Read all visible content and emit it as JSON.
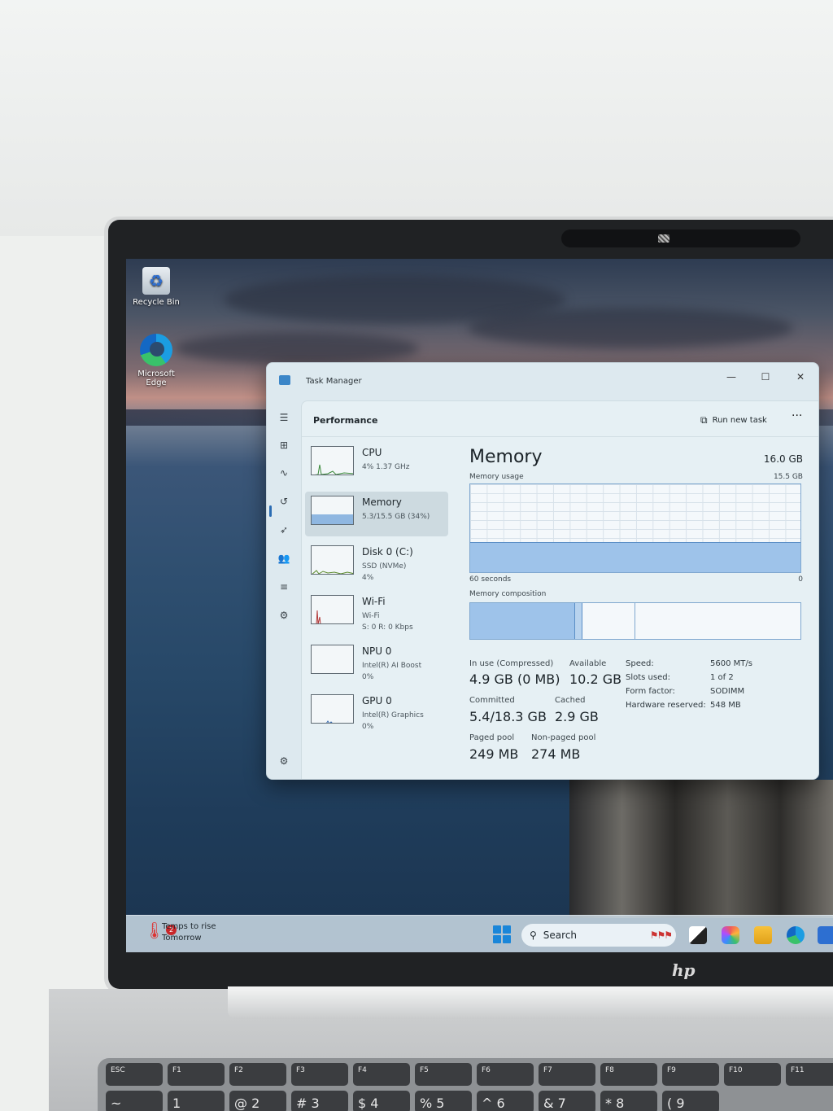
{
  "desktop": {
    "icons": [
      {
        "label": "Recycle Bin",
        "glyph": "recycle-bin-icon"
      },
      {
        "label": "Microsoft Edge",
        "glyph": "edge-icon"
      }
    ]
  },
  "window": {
    "title": "Task Manager",
    "controls": {
      "minimize": "—",
      "maximize": "☐",
      "close": "✕"
    }
  },
  "nav": [
    {
      "icon": "hamburger-icon",
      "glyph": "☰"
    },
    {
      "icon": "processes-icon",
      "glyph": "⊞"
    },
    {
      "icon": "performance-icon",
      "glyph": "∿"
    },
    {
      "icon": "app-history-icon",
      "glyph": "↺"
    },
    {
      "icon": "startup-apps-icon",
      "glyph": "➶"
    },
    {
      "icon": "users-icon",
      "glyph": "👥"
    },
    {
      "icon": "details-icon",
      "glyph": "≡"
    },
    {
      "icon": "services-icon",
      "glyph": "⚙"
    },
    {
      "icon": "settings-icon",
      "glyph": "⚙"
    }
  ],
  "header": {
    "page_title": "Performance",
    "run_new_task": "Run new task",
    "more": "···"
  },
  "resources": [
    {
      "name": "CPU",
      "sub1": "4% 1.37 GHz",
      "sub2": "",
      "fill": 0.04
    },
    {
      "name": "Memory",
      "sub1": "5.3/15.5 GB (34%)",
      "sub2": "",
      "fill": 0.34
    },
    {
      "name": "Disk 0 (C:)",
      "sub1": "SSD (NVMe)",
      "sub2": "4%",
      "fill": 0.04
    },
    {
      "name": "Wi-Fi",
      "sub1": "Wi-Fi",
      "sub2": "S: 0 R: 0 Kbps",
      "fill": 0.0
    },
    {
      "name": "NPU 0",
      "sub1": "Intel(R) AI Boost",
      "sub2": "0%",
      "fill": 0.0
    },
    {
      "name": "GPU 0",
      "sub1": "Intel(R) Graphics",
      "sub2": "0%",
      "fill": 0.0
    }
  ],
  "memory": {
    "title": "Memory",
    "total": "16.0 GB",
    "usage_label": "Memory usage",
    "usage_max": "15.5 GB",
    "usage_fraction": 0.34,
    "time_left": "60 seconds",
    "time_right": "0",
    "composition_label": "Memory composition",
    "composition": {
      "in_use": 0.316,
      "modified": 0.025,
      "standby": 0.16
    },
    "stats": {
      "in_use_label": "In use (Compressed)",
      "in_use_value": "4.9 GB (0 MB)",
      "available_label": "Available",
      "available_value": "10.2 GB",
      "committed_label": "Committed",
      "committed_value": "5.4/18.3 GB",
      "cached_label": "Cached",
      "cached_value": "2.9 GB",
      "paged_label": "Paged pool",
      "paged_value": "249 MB",
      "nonpaged_label": "Non-paged pool",
      "nonpaged_value": "274 MB"
    },
    "specs": [
      {
        "label": "Speed:",
        "value": "5600 MT/s"
      },
      {
        "label": "Slots used:",
        "value": "1 of 2"
      },
      {
        "label": "Form factor:",
        "value": "SODIMM"
      },
      {
        "label": "Hardware reserved:",
        "value": "548 MB"
      }
    ]
  },
  "taskbar": {
    "weather_title": "Temps to rise",
    "weather_sub": "Tomorrow",
    "notification_count": "2",
    "search_placeholder": "Search"
  },
  "colors": {
    "graph_fill": "#9ec3ea",
    "graph_border": "#7fa7cf",
    "accent": "#2b6cb3"
  },
  "keyboard": {
    "keys": [
      "ESC",
      "F1",
      "F2",
      "F3",
      "F4",
      "F5",
      "F6",
      "F7",
      "F8",
      "F9",
      "F10",
      "F11"
    ],
    "number_keys": [
      "~",
      "1",
      "@ 2",
      "# 3",
      "$ 4",
      "% 5",
      "^ 6",
      "& 7",
      "* 8",
      "( 9"
    ]
  },
  "brand": "hp"
}
